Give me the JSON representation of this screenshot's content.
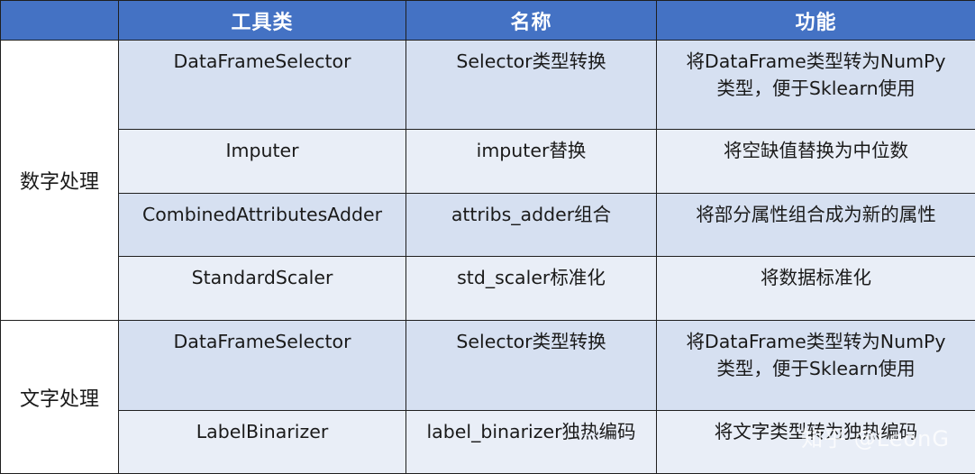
{
  "header": {
    "col1": "",
    "col2": "工具类",
    "col3": "名称",
    "col4": "功能"
  },
  "groups": [
    {
      "label": "数字处理",
      "rows": [
        {
          "tool": "DataFrameSelector",
          "name": "Selector类型转换",
          "func_line1": "将DataFrame类型转为NumPy",
          "func_line2": "类型，便于Sklearn使用"
        },
        {
          "tool": "Imputer",
          "name": "imputer替换",
          "func_line1": "将空缺值替换为中位数",
          "func_line2": ""
        },
        {
          "tool": "CombinedAttributesAdder",
          "name": "attribs_adder组合",
          "func_line1": "将部分属性组合成为新的属性",
          "func_line2": ""
        },
        {
          "tool": "StandardScaler",
          "name": "std_scaler标准化",
          "func_line1": "将数据标准化",
          "func_line2": ""
        }
      ]
    },
    {
      "label": "文字处理",
      "rows": [
        {
          "tool": "DataFrameSelector",
          "name": "Selector类型转换",
          "func_line1": "将DataFrame类型转为NumPy",
          "func_line2": "类型，便于Sklearn使用"
        },
        {
          "tool": "LabelBinarizer",
          "name": "label_binarizer独热编码",
          "func_line1": "将文字类型转为独热编码",
          "func_line2": ""
        }
      ]
    }
  ],
  "watermark": "知乎 @LeonG"
}
